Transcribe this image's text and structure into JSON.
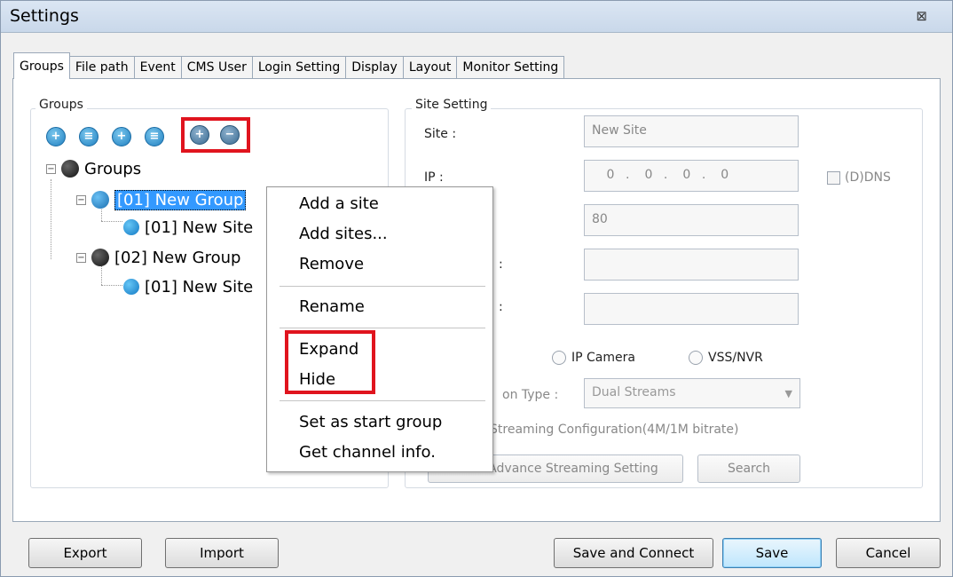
{
  "window": {
    "title": "Settings",
    "close_glyph": "⊠"
  },
  "tabs": [
    {
      "label": "Groups",
      "active": true
    },
    {
      "label": "File path",
      "active": false
    },
    {
      "label": "Event",
      "active": false
    },
    {
      "label": "CMS User",
      "active": false
    },
    {
      "label": "Login Setting",
      "active": false
    },
    {
      "label": "Display",
      "active": false
    },
    {
      "label": "Layout",
      "active": false
    },
    {
      "label": "Monitor Setting",
      "active": false
    }
  ],
  "groups_panel": {
    "legend": "Groups",
    "toolbar": [
      {
        "icon": "add-group-icon",
        "glyph": "+"
      },
      {
        "icon": "edit-group-icon",
        "glyph": "≡"
      },
      {
        "icon": "add-site-icon",
        "glyph": "+"
      },
      {
        "icon": "edit-site-icon",
        "glyph": "≡"
      },
      {
        "icon": "expand-all-icon",
        "glyph": "+"
      },
      {
        "icon": "collapse-all-icon",
        "glyph": "−"
      }
    ],
    "tree": {
      "root": "Groups",
      "nodes": [
        {
          "label": "[01] New Group",
          "selected": true
        },
        {
          "label": "[01] New Site"
        },
        {
          "label": "[02] New Group"
        },
        {
          "label": "[01] New Site"
        }
      ]
    }
  },
  "site_panel": {
    "legend": "Site Setting",
    "site_label": "Site :",
    "site_value": "New Site",
    "ip_label": "IP :",
    "ip_parts": [
      "0",
      "0",
      "0",
      "0"
    ],
    "ddns_label": "(D)DNS",
    "port_value": "80",
    "colon_1": ":",
    "colon_2": ":",
    "radio_ip_camera": "IP Camera",
    "radio_vss": "VSS/NVR",
    "conn_type_label": "on Type :",
    "conn_type_value": "Dual Streams",
    "streaming_config": "Streaming Configuration(4M/1M bitrate)",
    "advance_button": "Advance Streaming Setting",
    "search_button": "Search"
  },
  "context_menu": {
    "items": [
      "Add a site",
      "Add sites...",
      "Remove",
      "Rename",
      "Expand",
      "Hide",
      "Set as start group",
      "Get channel info."
    ]
  },
  "footer": {
    "export": "Export",
    "import": "Import",
    "save_connect": "Save and Connect",
    "save": "Save",
    "cancel": "Cancel"
  },
  "colors": {
    "highlight": "#e0141e",
    "selection": "#3399ff"
  }
}
